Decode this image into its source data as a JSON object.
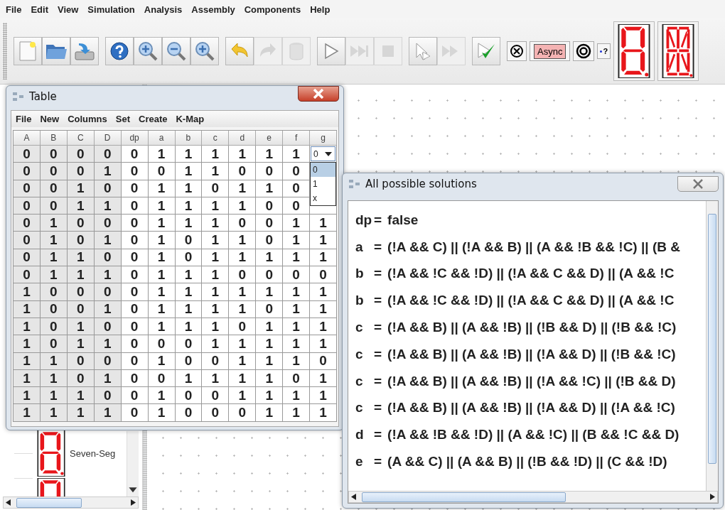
{
  "menu_bar": [
    "File",
    "Edit",
    "View",
    "Simulation",
    "Analysis",
    "Assembly",
    "Components",
    "Help"
  ],
  "toolbar": [
    [
      {
        "kind": "new",
        "disabled": false
      },
      {
        "kind": "open",
        "disabled": false
      },
      {
        "kind": "save",
        "disabled": false
      }
    ],
    [
      {
        "kind": "help",
        "disabled": false
      },
      {
        "kind": "zoom-in",
        "disabled": false
      },
      {
        "kind": "zoom-out",
        "disabled": false
      },
      {
        "kind": "zoom-fit",
        "disabled": false
      }
    ],
    [
      {
        "kind": "undo",
        "disabled": false
      },
      {
        "kind": "redo",
        "disabled": true
      },
      {
        "kind": "delete",
        "disabled": true
      }
    ],
    [
      {
        "kind": "run",
        "disabled": false
      },
      {
        "kind": "step",
        "disabled": true
      },
      {
        "kind": "stop",
        "disabled": true
      }
    ],
    [
      {
        "kind": "select",
        "disabled": false
      },
      {
        "kind": "fast-forward",
        "disabled": true
      }
    ],
    [
      {
        "kind": "check",
        "disabled": false
      }
    ]
  ],
  "tool_buttons": [
    {
      "kind": "reset"
    },
    {
      "kind": "text",
      "label": "Async"
    },
    {
      "kind": "target"
    },
    {
      "kind": "probe",
      "label": "?"
    }
  ],
  "explorer": {
    "items": [
      {
        "label": "Seven-Seg"
      }
    ]
  },
  "table_window": {
    "title": "Table",
    "menu": [
      "File",
      "New",
      "Columns",
      "Set",
      "Create",
      "K-Map"
    ],
    "columns": [
      {
        "label": "A",
        "kind": "input"
      },
      {
        "label": "B",
        "kind": "input"
      },
      {
        "label": "C",
        "kind": "input"
      },
      {
        "label": "D",
        "kind": "input"
      },
      {
        "label": "dp",
        "kind": "output"
      },
      {
        "label": "a",
        "kind": "output"
      },
      {
        "label": "b",
        "kind": "output"
      },
      {
        "label": "c",
        "kind": "output"
      },
      {
        "label": "d",
        "kind": "output"
      },
      {
        "label": "e",
        "kind": "output"
      },
      {
        "label": "f",
        "kind": "output"
      },
      {
        "label": "g",
        "kind": "output"
      }
    ],
    "rows": [
      [
        "0",
        "0",
        "0",
        "0",
        "0",
        "1",
        "1",
        "1",
        "1",
        "1",
        "1"
      ],
      [
        "0",
        "0",
        "0",
        "1",
        "0",
        "0",
        "1",
        "1",
        "0",
        "0",
        "0"
      ],
      [
        "0",
        "0",
        "1",
        "0",
        "0",
        "1",
        "1",
        "0",
        "1",
        "1",
        "0"
      ],
      [
        "0",
        "0",
        "1",
        "1",
        "0",
        "1",
        "1",
        "1",
        "1",
        "0",
        "0"
      ],
      [
        "0",
        "1",
        "0",
        "0",
        "0",
        "1",
        "1",
        "1",
        "0",
        "0",
        "1",
        "1"
      ],
      [
        "0",
        "1",
        "0",
        "1",
        "0",
        "1",
        "0",
        "1",
        "1",
        "0",
        "1",
        "1"
      ],
      [
        "0",
        "1",
        "1",
        "0",
        "0",
        "1",
        "0",
        "1",
        "1",
        "1",
        "1",
        "1"
      ],
      [
        "0",
        "1",
        "1",
        "1",
        "0",
        "1",
        "1",
        "1",
        "0",
        "0",
        "0",
        "0"
      ],
      [
        "1",
        "0",
        "0",
        "0",
        "0",
        "1",
        "1",
        "1",
        "1",
        "1",
        "1",
        "1"
      ],
      [
        "1",
        "0",
        "0",
        "1",
        "0",
        "1",
        "1",
        "1",
        "1",
        "0",
        "1",
        "1"
      ],
      [
        "1",
        "0",
        "1",
        "0",
        "0",
        "1",
        "1",
        "1",
        "0",
        "1",
        "1",
        "1"
      ],
      [
        "1",
        "0",
        "1",
        "1",
        "0",
        "0",
        "0",
        "1",
        "1",
        "1",
        "1",
        "1"
      ],
      [
        "1",
        "1",
        "0",
        "0",
        "0",
        "1",
        "0",
        "0",
        "1",
        "1",
        "1",
        "0"
      ],
      [
        "1",
        "1",
        "0",
        "1",
        "0",
        "0",
        "1",
        "1",
        "1",
        "1",
        "0",
        "1"
      ],
      [
        "1",
        "1",
        "1",
        "0",
        "0",
        "1",
        "0",
        "0",
        "1",
        "1",
        "1",
        "1"
      ],
      [
        "1",
        "1",
        "1",
        "1",
        "0",
        "1",
        "0",
        "0",
        "0",
        "1",
        "1",
        "1"
      ]
    ],
    "cell_editor": {
      "value": "0",
      "options": [
        {
          "label": "0",
          "selected": true
        },
        {
          "label": "1",
          "selected": false
        },
        {
          "label": "x",
          "selected": false
        }
      ]
    }
  },
  "solutions_window": {
    "title": "All possible solutions",
    "lines": [
      {
        "name": "dp",
        "sign": "=",
        "expr": "false"
      },
      {
        "name": "a",
        "sign": "=",
        "expr": "(!A && C) || (!A && B) || (A && !B && !C) || (B &"
      },
      {
        "name": "b",
        "sign": "=",
        "expr": "(!A && !C && !D) || (!A && C && D) || (A && !C"
      },
      {
        "name": "b",
        "sign": "=",
        "expr": "(!A && !C && !D) || (!A && C && D) || (A && !C"
      },
      {
        "name": "c",
        "sign": "=",
        "expr": "(!A && B) || (A && !B) || (!B && D) || (!B && !C)"
      },
      {
        "name": "c",
        "sign": "=",
        "expr": "(!A && B) || (A && !B) || (!A && D) || (!B && !C)"
      },
      {
        "name": "c",
        "sign": "=",
        "expr": "(!A && B) || (A && !B) || (!A && !C) || (!B && D)"
      },
      {
        "name": "c",
        "sign": "=",
        "expr": "(!A && B) || (A && !B) || (!A && D) || (!A && !C)"
      },
      {
        "name": "d",
        "sign": "=",
        "expr": "(!A && !B && !D) || (A && !C) || (B && !C && D)"
      },
      {
        "name": "e",
        "sign": "=",
        "expr": "(A && C) || (A && B) || (!B && !D) || (C && !D)"
      }
    ]
  }
}
